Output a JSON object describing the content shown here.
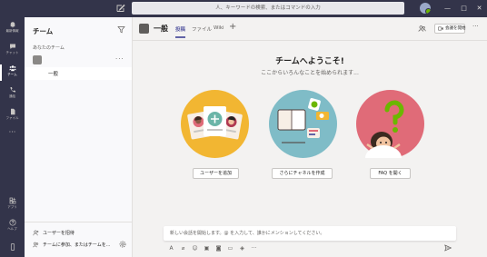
{
  "titlebar": {
    "search_placeholder": "人、キーワードの検索、またはコマンドの入力"
  },
  "appbar": {
    "items": [
      {
        "label": "最新情報",
        "icon": "bell-icon"
      },
      {
        "label": "チャット",
        "icon": "chat-icon"
      },
      {
        "label": "チーム",
        "icon": "teams-icon"
      },
      {
        "label": "通話",
        "icon": "phone-icon"
      },
      {
        "label": "ファイル",
        "icon": "file-icon"
      },
      {
        "label": "アプリ",
        "icon": "apps-icon"
      },
      {
        "label": "ヘルプ",
        "icon": "help-icon"
      }
    ]
  },
  "sidebar": {
    "title": "チーム",
    "section_label": "あなたのチーム",
    "channel_label": "一般",
    "join_link": "ユーザーを招待",
    "create_link": "チームに参加、またはチームを..."
  },
  "header": {
    "channel_title": "一般",
    "tabs": [
      {
        "label": "投稿",
        "active": true
      },
      {
        "label": "ファイル",
        "active": false
      },
      {
        "label": "Wiki",
        "active": false
      }
    ],
    "meet_label": "会議を開始"
  },
  "welcome": {
    "title": "チームへようこそ!",
    "subtitle": "ここからいろんなことを始められます...",
    "buttons": [
      {
        "label": "ユーザーを追加"
      },
      {
        "label": "さらにチャネルを作成"
      },
      {
        "label": "FAQ を開く"
      }
    ]
  },
  "compose": {
    "placeholder": "新しい会話を開始します。@ を入力して、誰かにメンションしてください。"
  },
  "colors": {
    "appbar": "#33344a",
    "accent": "#6264a7",
    "card_yellow": "#f2b632",
    "card_teal": "#7fbcc7",
    "card_pink": "#e06b78"
  }
}
